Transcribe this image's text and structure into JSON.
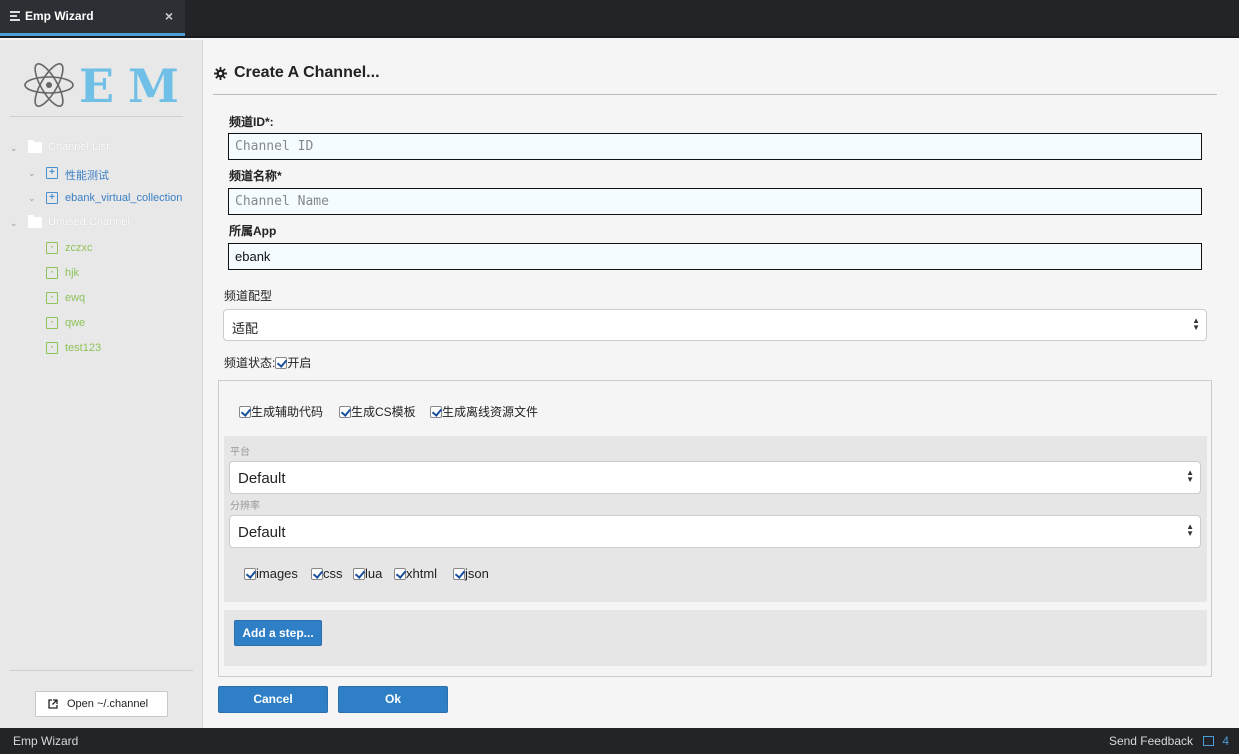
{
  "tab": {
    "title": "Emp Wizard",
    "close": "×"
  },
  "logo": {
    "text": "EMP"
  },
  "sidebar": {
    "groups": [
      {
        "label": "Channel List",
        "items": [
          {
            "label": "性能测试",
            "icon": "plus-box-icon"
          },
          {
            "label": "ebank_virtual_collection",
            "icon": "plus-box-icon"
          }
        ]
      },
      {
        "label": "Unused Channel",
        "items": [
          {
            "label": "zczxc",
            "icon": "dot-box-icon"
          },
          {
            "label": "hjk",
            "icon": "dot-box-icon"
          },
          {
            "label": "ewq",
            "icon": "dot-box-icon"
          },
          {
            "label": "qwe",
            "icon": "dot-box-icon"
          },
          {
            "label": "test123",
            "icon": "dot-box-icon"
          }
        ]
      }
    ],
    "open_button": "Open ~/.channel"
  },
  "panel": {
    "title": "Create A Channel...",
    "channel_id": {
      "label": "频道ID*:",
      "placeholder": "Channel ID",
      "value": ""
    },
    "channel_name": {
      "label": "频道名称*",
      "placeholder": "Channel Name",
      "value": ""
    },
    "app": {
      "label": "所属App",
      "value": "ebank"
    },
    "adapter": {
      "label": "频道配型",
      "selected": "适配"
    },
    "status": {
      "label": "频道状态:",
      "option": "开启"
    },
    "generate": [
      "生成辅助代码",
      "生成CS模板",
      "生成离线资源文件"
    ],
    "platform": {
      "label": "平台",
      "selected": "Default"
    },
    "resolution": {
      "label": "分辨率",
      "selected": "Default"
    },
    "resources": [
      "images",
      "css",
      "lua",
      "xhtml",
      "json"
    ],
    "add_step": "Add a step...",
    "cancel": "Cancel",
    "ok": "Ok"
  },
  "statusbar": {
    "left": "Emp Wizard",
    "feedback": "Send Feedback",
    "count": "4"
  },
  "colors": {
    "accent": "#2e7fc6",
    "tab_underline": "#4c9ed9",
    "green": "#8fc25a",
    "blue": "#3a7fc4"
  }
}
